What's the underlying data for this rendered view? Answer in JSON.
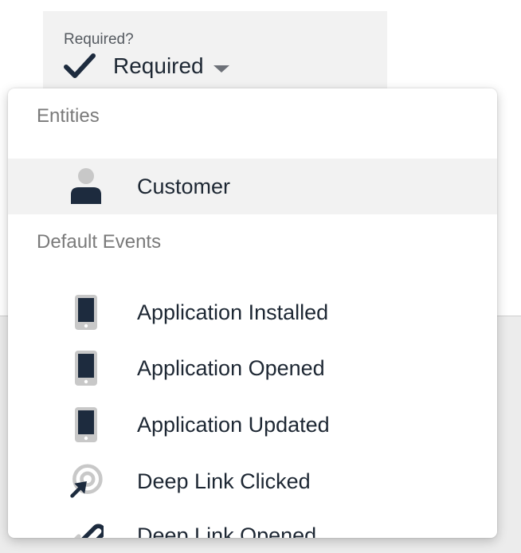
{
  "required_field": {
    "label": "Required?",
    "value": "Required"
  },
  "dropdown": {
    "sections": [
      {
        "header": "Entities",
        "items": [
          {
            "label": "Customer",
            "icon": "person-icon",
            "highlighted": true
          }
        ]
      },
      {
        "header": "Default Events",
        "items": [
          {
            "label": "Application Installed",
            "icon": "mobile-phone-icon"
          },
          {
            "label": "Application Opened",
            "icon": "mobile-phone-icon"
          },
          {
            "label": "Application Updated",
            "icon": "mobile-phone-icon"
          },
          {
            "label": "Deep Link Clicked",
            "icon": "cursor-target-icon"
          },
          {
            "label": "Deep Link Opened",
            "icon": "link-icon"
          }
        ]
      }
    ]
  },
  "colors": {
    "text_dark": "#1d2733",
    "header_grey": "#7a7a7a",
    "icon_dark": "#1d2b3e",
    "icon_light": "#c8c8c8",
    "highlight_bg": "#f2f2f2"
  }
}
